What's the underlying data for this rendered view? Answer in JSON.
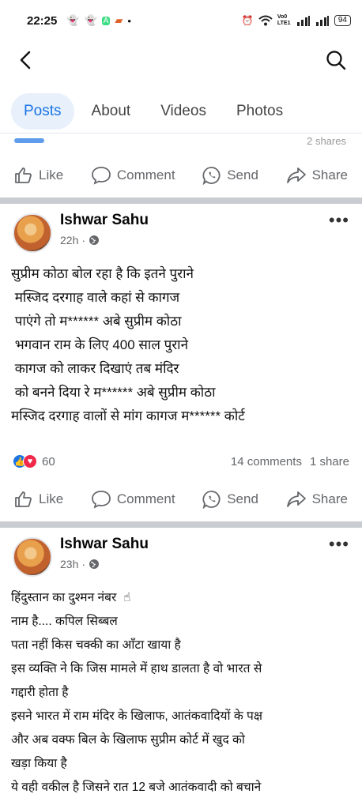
{
  "status_bar": {
    "time": "22:25",
    "left_icons": [
      "snapchat-icon",
      "snapchat-icon",
      "android-icon",
      "photos-icon",
      "dot-icon"
    ],
    "right_icons": [
      "alarm-icon",
      "wifi-icon",
      "volte-icon",
      "signal-icon",
      "signal-icon"
    ],
    "volte_label": "Vo0 LTE1",
    "battery": "94"
  },
  "nav": {
    "back_icon": "arrow-back-icon",
    "search_icon": "search-icon"
  },
  "tabs": [
    {
      "label": "Posts",
      "active": true
    },
    {
      "label": "About",
      "active": false
    },
    {
      "label": "Videos",
      "active": false
    },
    {
      "label": "Photos",
      "active": false
    }
  ],
  "partial_post": {
    "shares_text": "2 shares"
  },
  "actions": {
    "like": "Like",
    "comment": "Comment",
    "send": "Send",
    "share": "Share"
  },
  "posts": [
    {
      "author": "Ishwar Sahu",
      "time": "22h",
      "privacy_icon": "globe-icon",
      "text": "सुप्रीम कोठा बोल रहा है कि इतने पुराने\n मस्जिद दरगाह वाले कहां से कागज\n पाएंगे तो म****** अबे सुप्रीम कोठा\n भगवान राम के लिए 400 साल पुराने\n कागज को लाकर दिखाएं तब मंदिर\n को बनने दिया रे म****** अबे सुप्रीम कोठा\nमस्जिद दरगाह वालों से मांग कागज म****** कोर्ट",
      "reaction_count": "60",
      "comments": "14 comments",
      "shares": "1 share"
    },
    {
      "author": "Ishwar Sahu",
      "time": "23h",
      "privacy_icon": "globe-icon",
      "text": "हिंदुस्तान का दुश्मन नंबर  ☝\nनाम है.... कपिल सिब्बल\nपता नहीं किस चक्की का आँटा खाया है\nइस व्यक्ति ने कि जिस मामले में हाथ डालता है वो भारत से\nगद्दारी होता है\nइसने भारत में राम मंदिर के खिलाफ, आतंकवादियों के पक्ष\nऔर अब वक्फ बिल के खिलाफ सुप्रीम कोर्ट में खुद को\nखड़ा किया है\nये वही वकील है जिसने रात 12 बजे आतंकवादी को बचाने"
    }
  ]
}
